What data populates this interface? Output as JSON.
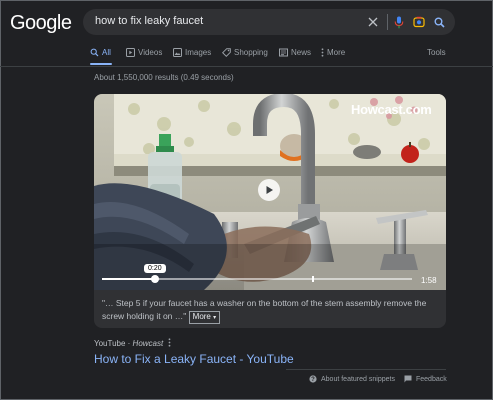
{
  "logo": "Google",
  "search": {
    "query": "how to fix leaky faucet",
    "icons": [
      "close-icon",
      "mic-icon",
      "lens-icon",
      "search-icon"
    ]
  },
  "tabs": [
    {
      "label": "All",
      "icon": "search-icon",
      "active": true
    },
    {
      "label": "Videos",
      "icon": "video-icon"
    },
    {
      "label": "Images",
      "icon": "image-icon"
    },
    {
      "label": "Shopping",
      "icon": "tag-icon"
    },
    {
      "label": "News",
      "icon": "news-icon"
    },
    {
      "label": "More",
      "icon": "kebab-icon"
    }
  ],
  "tools_label": "Tools",
  "stats": "About 1,550,000 results (0.49 seconds)",
  "video": {
    "watermark": "Howcast.com",
    "current_time": "0:20",
    "duration": "1:58",
    "progress_fraction": 0.17,
    "chapter_fraction": 0.68,
    "snippet": "\"… Step 5 if your faucet has a washer on the bottom of the stem assembly remove the screw holding it on …\"",
    "more_label": "More"
  },
  "result": {
    "site": "YouTube",
    "channel": "Howcast",
    "title": "How to Fix a Leaky Faucet - YouTube"
  },
  "footer": {
    "about_label": "About featured snippets",
    "feedback_label": "Feedback"
  },
  "colors": {
    "background": "#202124",
    "link": "#8ab4f8",
    "search_bar": "#303134"
  }
}
